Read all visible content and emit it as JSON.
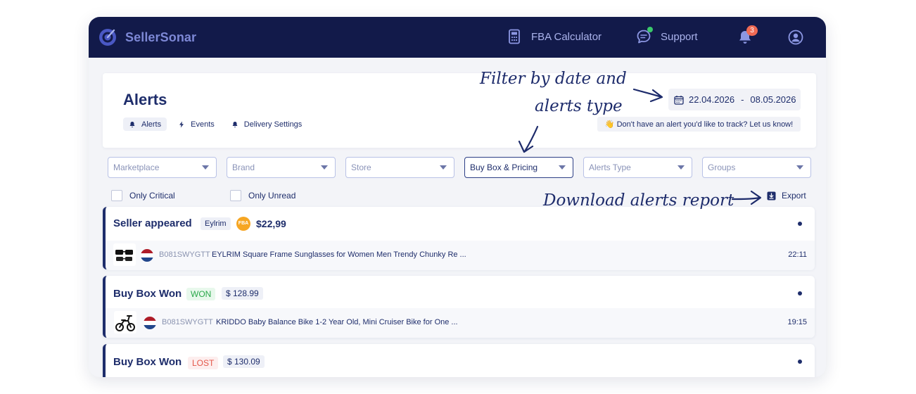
{
  "app": {
    "name": "SellerSonar",
    "nav": {
      "fba_calculator": "FBA Calculator",
      "support": "Support",
      "notifications_count": "3"
    }
  },
  "header": {
    "title": "Alerts",
    "tabs": [
      {
        "label": "Alerts",
        "icon": "bell-icon",
        "active": true
      },
      {
        "label": "Events",
        "icon": "lightning-icon",
        "active": false
      },
      {
        "label": "Delivery Settings",
        "icon": "bell-icon",
        "active": false
      }
    ],
    "date_range": {
      "start": "22.04.2026",
      "separator": "-",
      "end": "08.05.2026"
    },
    "hint": "👋 Don't have an alert you'd like to track? Let us know!"
  },
  "annotations": {
    "filter_line1": "Filter by date and",
    "filter_line2": "alerts type",
    "download": "Download alerts report"
  },
  "filters": {
    "selects": [
      {
        "label": "Marketplace",
        "selected": false
      },
      {
        "label": "Brand",
        "selected": false
      },
      {
        "label": "Store",
        "selected": false
      },
      {
        "label": "Buy Box & Pricing",
        "selected": true
      },
      {
        "label": "Alerts Type",
        "selected": false
      },
      {
        "label": "Groups",
        "selected": false
      }
    ],
    "only_critical": "Only Critical",
    "only_unread": "Only Unread",
    "export": "Export"
  },
  "alerts": [
    {
      "title": "Seller appeared",
      "store": "Eylrim",
      "fba_badge": "FBA",
      "price": "$22,99",
      "asin": "B081SWYGTT",
      "product": "EYLRIM Square Frame Sunglasses for Women Men Trendy Chunky Re ...",
      "time": "22:11",
      "thumb": "sunglasses-thumbnail"
    },
    {
      "title": "Buy Box Won",
      "status": "WON",
      "price": "$ 128.99",
      "asin": "B081SWYGTT",
      "product": "KRIDDO Baby Balance Bike 1-2 Year Old, Mini Cruiser Bike for One  ...",
      "time": "19:15",
      "thumb": "balance-bike-thumbnail"
    },
    {
      "title": "Buy Box Won",
      "status": "LOST",
      "price": "$ 130.09"
    }
  ],
  "colors": {
    "navbar": "#121a4a",
    "primary": "#1e2d6b",
    "won": "#2aa84a",
    "lost": "#e4574a",
    "fba": "#f6a623",
    "flag_red": "#ae1c28",
    "flag_blue": "#21468b"
  }
}
